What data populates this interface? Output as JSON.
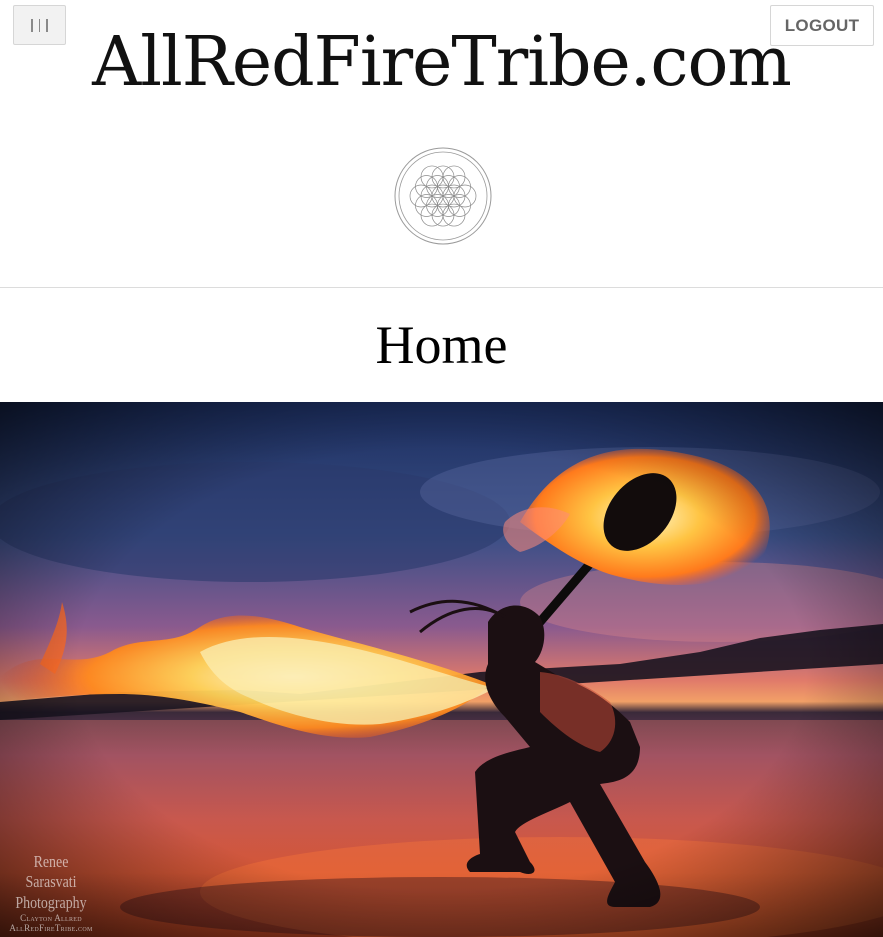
{
  "header": {
    "menu_icon": "hamburger-menu-icon",
    "logout_label": "LOGOUT",
    "site_title": "AllRedFireTribe.com",
    "emblem_icon": "flower-of-life-icon"
  },
  "page": {
    "title": "Home"
  },
  "hero": {
    "credit_line1": "Renee Sarasvati",
    "credit_line2": "Photography",
    "credit_line3": "Clayton Allred",
    "credit_line4": "AllRedFireTribe.com"
  },
  "colors": {
    "header_bg": "#ffffff",
    "divider": "#dcdcdc",
    "logout_text": "#666666",
    "flame": "#ffb13b"
  }
}
